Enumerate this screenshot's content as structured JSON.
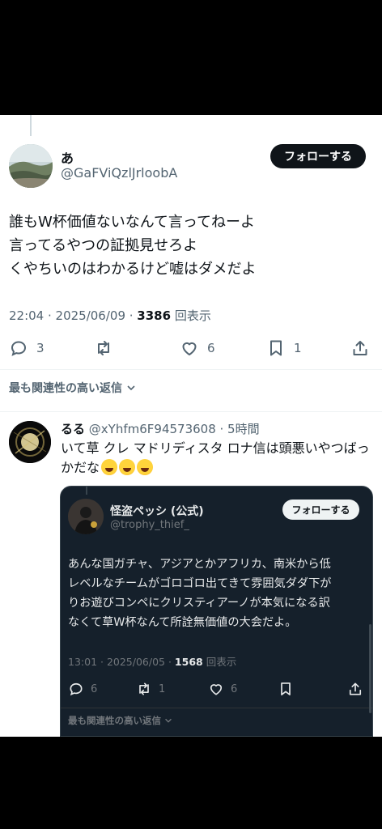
{
  "main_tweet": {
    "display_name": "あ",
    "handle": "@GaFViQzlJrloobA",
    "follow_label": "フォローする",
    "text_lines": [
      "誰もW杯価値ないなんて言ってねーよ",
      "言ってるやつの証拠見せろよ",
      "くやちいのはわかるけど嘘はダメだよ"
    ],
    "time": "22:04 · 2025/06/09 · ",
    "views": "3386",
    "views_label": " 回表示",
    "replies": "3",
    "retweets": "",
    "likes": "6",
    "bookmarks": "1"
  },
  "sort_label": "最も関連性の高い返信",
  "reply": {
    "display_name": "るる",
    "handle": " @xYhfm6F94573608 · 5時間",
    "text": "いて草 クレ マドリディスタ ロナ信は頭悪いやつばっかだな",
    "emoji_name": "joy-emoji"
  },
  "quoted_tweet": {
    "display_name": "怪盗ペッシ (公式)",
    "handle": "@trophy_thief_",
    "follow_label": "フォローする",
    "text_lines": [
      "あんな国ガチャ、アジアとかアフリカ、南米から低",
      "レベルなチームがゴロゴロ出てきて雰囲気ダダ下が",
      "りお遊びコンペにクリスティアーノが本気になる訳",
      "なくて草W杯なんて所詮無価値の大会だよ。"
    ],
    "time": "13:01 · 2025/06/05 · ",
    "views": "1568",
    "views_label": " 回表示",
    "replies": "6",
    "retweets": "1",
    "likes": "6",
    "sort_label": "最も関連性の高い返信"
  },
  "colors": {
    "text": "#0f1419",
    "muted": "#536471",
    "dark_bg": "#15202b",
    "follow_bg": "#0f1419"
  }
}
